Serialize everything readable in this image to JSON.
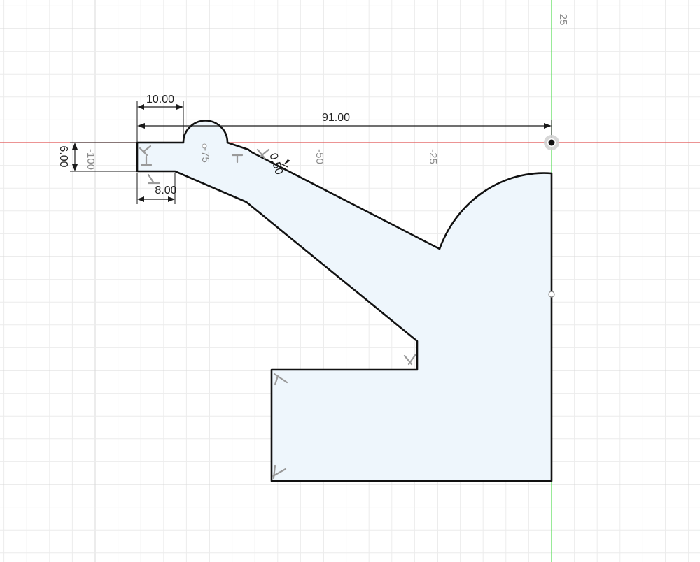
{
  "sketch": {
    "fill_color": "#eef6fc",
    "outline_color": "#111111",
    "x_axis_color": "#e05555",
    "y_axis_color": "#55dd55",
    "origin_marker": "origin-point-icon"
  },
  "dimensions": {
    "overall_width": "91.00",
    "top_flat_width": "10.00",
    "lower_flat_width": "8.00",
    "end_height": "6.00",
    "fillet_radius": "0.50"
  },
  "axis_labels": {
    "y_top": "25",
    "x_neg100": "-100",
    "x_neg75": "-75",
    "x_neg50": "-50",
    "x_neg25": "-25"
  }
}
